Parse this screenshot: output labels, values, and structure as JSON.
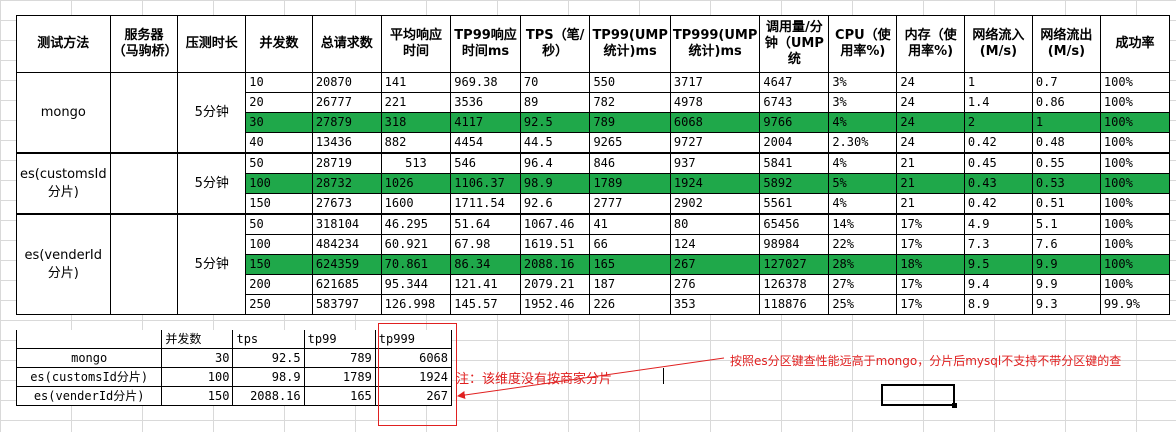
{
  "main_table": {
    "headers": [
      "测试方法",
      "服务器（马驹桥）",
      "压测时长",
      "并发数",
      "总请求数",
      "平均响应时间",
      "TP99响应时间ms",
      "TPS（笔/秒）",
      "TP99(UMP统计)ms",
      "TP999(UMP统计)ms",
      "调用量/分钟（UMP统",
      "CPU（使用率%)",
      "内存（使用率%)",
      "网络流入(M/s)",
      "网络流出(M/s)",
      "成功率"
    ],
    "groups": [
      {
        "method": "mongo",
        "server": "",
        "duration": "5分钟",
        "rows": [
          {
            "c": "10",
            "total": "20870",
            "avg": "141",
            "tp99": "969.38",
            "tps": "70",
            "ump99": "550",
            "ump999": "3717",
            "calls": "4647",
            "cpu": "3%",
            "mem": "24",
            "in": "1",
            "out": "0.7",
            "ok": "100%",
            "hl": false
          },
          {
            "c": "20",
            "total": "26777",
            "avg": "221",
            "tp99": "3536",
            "tps": "89",
            "ump99": "782",
            "ump999": "4978",
            "calls": "6743",
            "cpu": "3%",
            "mem": "24",
            "in": "1.4",
            "out": "0.86",
            "ok": "100%",
            "hl": false
          },
          {
            "c": "30",
            "total": "27879",
            "avg": "318",
            "tp99": "4117",
            "tps": "92.5",
            "ump99": "789",
            "ump999": "6068",
            "calls": "9766",
            "cpu": "4%",
            "mem": "24",
            "in": "2",
            "out": "1",
            "ok": "100%",
            "hl": true
          },
          {
            "c": "40",
            "total": "13436",
            "avg": "882",
            "tp99": "4454",
            "tps": "44.5",
            "ump99": "9265",
            "ump999": "9727",
            "calls": "2004",
            "cpu": "2.30%",
            "mem": "24",
            "in": "0.42",
            "out": "0.48",
            "ok": "100%",
            "hl": false
          }
        ]
      },
      {
        "method": "es(customsId分片)",
        "server": "",
        "duration": "5分钟",
        "rows": [
          {
            "c": "50",
            "total": "28719",
            "avg": "513",
            "tp99": "546",
            "tps": "96.4",
            "ump99": "846",
            "ump999": "937",
            "calls": "5841",
            "cpu": "4%",
            "mem": "21",
            "in": "0.45",
            "out": "0.55",
            "ok": "100%",
            "hl": false
          },
          {
            "c": "100",
            "total": "28732",
            "avg": "1026",
            "tp99": "1106.37",
            "tps": "98.9",
            "ump99": "1789",
            "ump999": "1924",
            "calls": "5892",
            "cpu": "5%",
            "mem": "21",
            "in": "0.43",
            "out": "0.53",
            "ok": "100%",
            "hl": true
          },
          {
            "c": "150",
            "total": "27673",
            "avg": "1600",
            "tp99": "1711.54",
            "tps": "92.6",
            "ump99": "2777",
            "ump999": "2902",
            "calls": "5561",
            "cpu": "4%",
            "mem": "21",
            "in": "0.42",
            "out": "0.51",
            "ok": "100%",
            "hl": false
          }
        ]
      },
      {
        "method": "es(venderId分片)",
        "server": "",
        "duration": "5分钟",
        "rows": [
          {
            "c": "50",
            "total": "318104",
            "avg": "46.295",
            "tp99": "51.64",
            "tps": "1067.46",
            "ump99": "41",
            "ump999": "80",
            "calls": "65456",
            "cpu": "14%",
            "mem": "17%",
            "in": "4.9",
            "out": "5.1",
            "ok": "100%",
            "hl": false
          },
          {
            "c": "100",
            "total": "484234",
            "avg": "60.921",
            "tp99": "67.98",
            "tps": "1619.51",
            "ump99": "66",
            "ump999": "124",
            "calls": "98984",
            "cpu": "22%",
            "mem": "17%",
            "in": "7.3",
            "out": "7.6",
            "ok": "100%",
            "hl": false
          },
          {
            "c": "150",
            "total": "624359",
            "avg": "70.861",
            "tp99": "86.34",
            "tps": "2088.16",
            "ump99": "165",
            "ump999": "267",
            "calls": "127027",
            "cpu": "28%",
            "mem": "18%",
            "in": "9.5",
            "out": "9.9",
            "ok": "100%",
            "hl": true
          },
          {
            "c": "200",
            "total": "621685",
            "avg": "95.344",
            "tp99": "121.41",
            "tps": "2079.21",
            "ump99": "187",
            "ump999": "276",
            "calls": "126378",
            "cpu": "27%",
            "mem": "17%",
            "in": "9.4",
            "out": "9.9",
            "ok": "100%",
            "hl": false
          },
          {
            "c": "250",
            "total": "583797",
            "avg": "126.998",
            "tp99": "145.57",
            "tps": "1952.46",
            "ump99": "226",
            "ump999": "353",
            "calls": "118876",
            "cpu": "25%",
            "mem": "17%",
            "in": "8.9",
            "out": "9.3",
            "ok": "99.9%",
            "hl": false
          }
        ]
      }
    ]
  },
  "summary_table": {
    "headers": [
      "",
      "并发数",
      "tps",
      "tp99",
      "tp999"
    ],
    "rows": [
      [
        "mongo",
        "30",
        "92.5",
        "789",
        "6068"
      ],
      [
        "es(customsId分片)",
        "100",
        "98.9",
        "1789",
        "1924"
      ],
      [
        "es(venderId分片)",
        "150",
        "2088.16",
        "165",
        "267"
      ]
    ]
  },
  "annotations": {
    "note": "注：该维度没有按商家分片",
    "remark": "按照es分区键查性能远高于mongo，分片后mysql不支持不带分区键的查"
  },
  "colors": {
    "highlight": "#1fa84a",
    "annotation": "#e02020"
  }
}
